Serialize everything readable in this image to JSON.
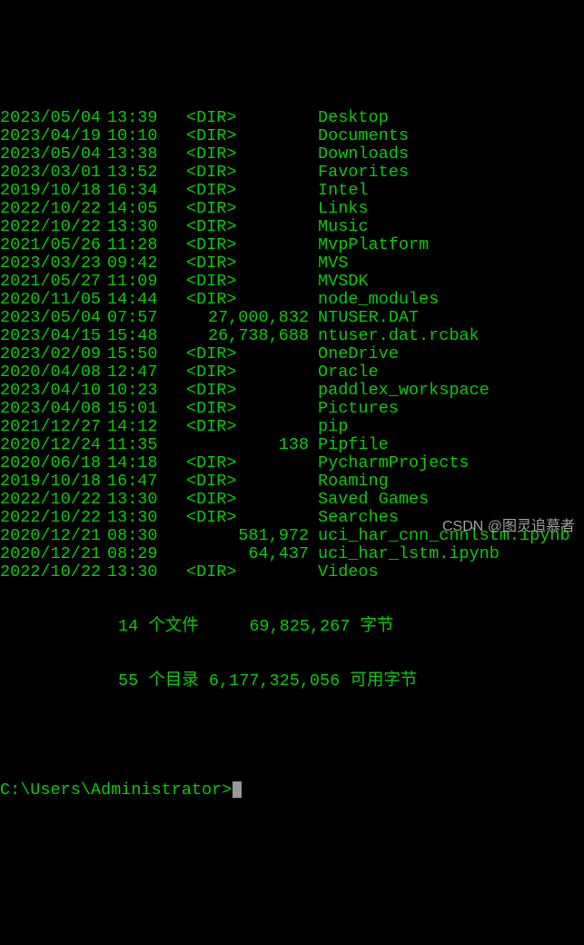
{
  "entries": [
    {
      "date": "2023/05/04",
      "time": "13:39",
      "type": "<DIR>",
      "isDir": true,
      "name": "Desktop"
    },
    {
      "date": "2023/04/19",
      "time": "10:10",
      "type": "<DIR>",
      "isDir": true,
      "name": "Documents"
    },
    {
      "date": "2023/05/04",
      "time": "13:38",
      "type": "<DIR>",
      "isDir": true,
      "name": "Downloads"
    },
    {
      "date": "2023/03/01",
      "time": "13:52",
      "type": "<DIR>",
      "isDir": true,
      "name": "Favorites"
    },
    {
      "date": "2019/10/18",
      "time": "16:34",
      "type": "<DIR>",
      "isDir": true,
      "name": "Intel"
    },
    {
      "date": "2022/10/22",
      "time": "14:05",
      "type": "<DIR>",
      "isDir": true,
      "name": "Links"
    },
    {
      "date": "2022/10/22",
      "time": "13:30",
      "type": "<DIR>",
      "isDir": true,
      "name": "Music"
    },
    {
      "date": "2021/05/26",
      "time": "11:28",
      "type": "<DIR>",
      "isDir": true,
      "name": "MvpPlatform"
    },
    {
      "date": "2023/03/23",
      "time": "09:42",
      "type": "<DIR>",
      "isDir": true,
      "name": "MVS"
    },
    {
      "date": "2021/05/27",
      "time": "11:09",
      "type": "<DIR>",
      "isDir": true,
      "name": "MVSDK"
    },
    {
      "date": "2020/11/05",
      "time": "14:44",
      "type": "<DIR>",
      "isDir": true,
      "name": "node_modules"
    },
    {
      "date": "2023/05/04",
      "time": "07:57",
      "type": "27,000,832",
      "isDir": false,
      "name": "NTUSER.DAT"
    },
    {
      "date": "2023/04/15",
      "time": "15:48",
      "type": "26,738,688",
      "isDir": false,
      "name": "ntuser.dat.rcbak"
    },
    {
      "date": "2023/02/09",
      "time": "15:50",
      "type": "<DIR>",
      "isDir": true,
      "name": "OneDrive"
    },
    {
      "date": "2020/04/08",
      "time": "12:47",
      "type": "<DIR>",
      "isDir": true,
      "name": "Oracle"
    },
    {
      "date": "2023/04/10",
      "time": "10:23",
      "type": "<DIR>",
      "isDir": true,
      "name": "paddlex_workspace"
    },
    {
      "date": "2023/04/08",
      "time": "15:01",
      "type": "<DIR>",
      "isDir": true,
      "name": "Pictures"
    },
    {
      "date": "2021/12/27",
      "time": "14:12",
      "type": "<DIR>",
      "isDir": true,
      "name": "pip"
    },
    {
      "date": "2020/12/24",
      "time": "11:35",
      "type": "138",
      "isDir": false,
      "name": "Pipfile"
    },
    {
      "date": "2020/06/18",
      "time": "14:18",
      "type": "<DIR>",
      "isDir": true,
      "name": "PycharmProjects"
    },
    {
      "date": "2019/10/18",
      "time": "16:47",
      "type": "<DIR>",
      "isDir": true,
      "name": "Roaming"
    },
    {
      "date": "2022/10/22",
      "time": "13:30",
      "type": "<DIR>",
      "isDir": true,
      "name": "Saved Games"
    },
    {
      "date": "2022/10/22",
      "time": "13:30",
      "type": "<DIR>",
      "isDir": true,
      "name": "Searches"
    },
    {
      "date": "2020/12/21",
      "time": "08:30",
      "type": "581,972",
      "isDir": false,
      "name": "uci_har_cnn_cnnlstm.ipynb"
    },
    {
      "date": "2020/12/21",
      "time": "08:29",
      "type": "64,437",
      "isDir": false,
      "name": "uci_har_lstm.ipynb"
    },
    {
      "date": "2022/10/22",
      "time": "13:30",
      "type": "<DIR>",
      "isDir": true,
      "name": "Videos"
    }
  ],
  "summary": {
    "line1": "14 个文件     69,825,267 字节",
    "line2": "55 个目录 6,177,325,056 可用字节"
  },
  "prompt": "C:\\Users\\Administrator>",
  "watermark": "CSDN @图灵追慕者"
}
